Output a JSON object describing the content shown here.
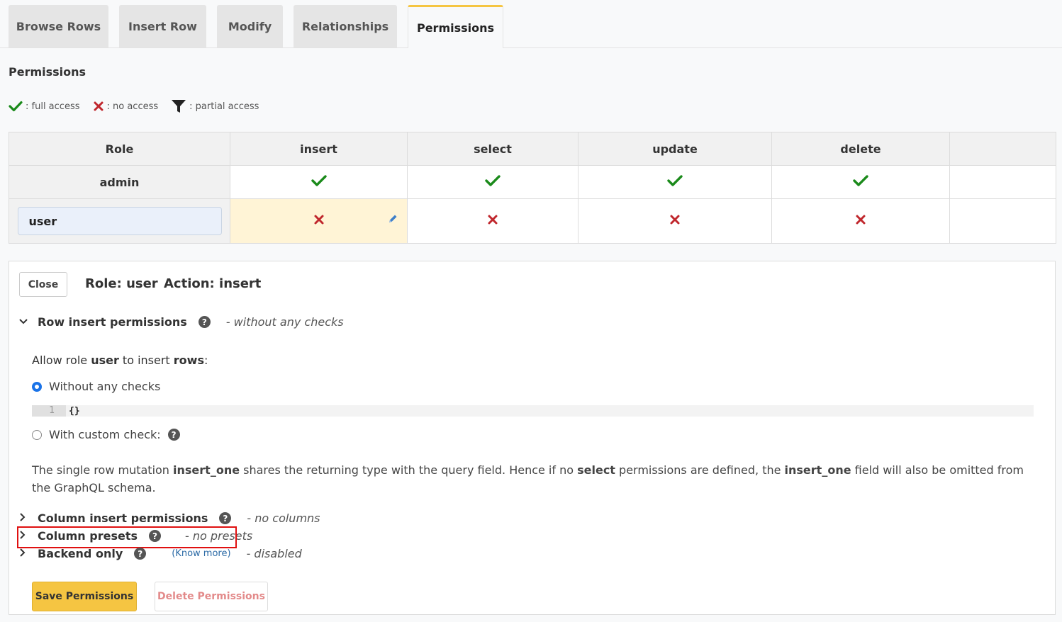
{
  "tabs": [
    {
      "label": "Browse Rows"
    },
    {
      "label": "Insert Row"
    },
    {
      "label": "Modify"
    },
    {
      "label": "Relationships"
    },
    {
      "label": "Permissions",
      "active": true
    }
  ],
  "section_title": "Permissions",
  "legend": {
    "full": ": full access",
    "none": ": no access",
    "partial": ": partial access"
  },
  "table": {
    "headers": [
      "Role",
      "insert",
      "select",
      "update",
      "delete",
      ""
    ],
    "rows": [
      {
        "role": "admin",
        "insert": "full",
        "select": "full",
        "update": "full",
        "delete": "full"
      },
      {
        "role": "user",
        "insert": "none",
        "select": "none",
        "update": "none",
        "delete": "none"
      }
    ]
  },
  "colors": {
    "check": "#1a8a1a",
    "cross": "#c0272d",
    "accent": "#f5c542"
  },
  "panel": {
    "close_label": "Close",
    "role_label": "Role: user",
    "action_label": "Action: insert",
    "row_insert": {
      "title": "Row insert permissions",
      "status_prefix": "- ",
      "status": "without any checks"
    },
    "allow_parts": {
      "p1": "Allow role ",
      "role": "user",
      "p2": " to insert ",
      "obj": "rows",
      "p3": ":"
    },
    "radio_without": "Without any checks",
    "code_line_no": "1",
    "code_content": "{}",
    "radio_custom": "With custom check:",
    "note_parts": {
      "a": "The single row mutation ",
      "b": "insert_one",
      "c": " shares the returning type with the query field. Hence if no ",
      "d": "select",
      "e": " permissions are defined, the ",
      "f": "insert_one",
      "g": " field will also be omitted from the GraphQL schema."
    },
    "column_insert": {
      "title": "Column insert permissions",
      "status_prefix": "- ",
      "status": "no columns"
    },
    "column_presets": {
      "title": "Column presets",
      "status_prefix": "- ",
      "status": "no presets"
    },
    "backend_only": {
      "title": "Backend only",
      "know_more": "(Know more)",
      "status_prefix": "- ",
      "status": "disabled"
    },
    "save_label": "Save Permissions",
    "delete_label": "Delete Permissions"
  }
}
